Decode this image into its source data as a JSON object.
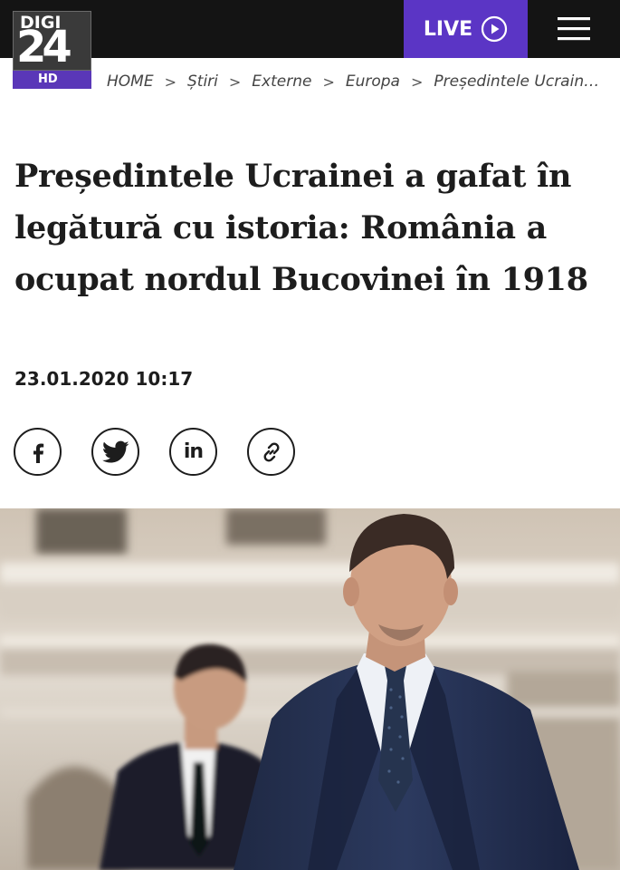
{
  "header": {
    "logo": {
      "brand": "DIGI",
      "number": "24",
      "badge": "HD"
    },
    "live_label": "LIVE",
    "live_icon": "play-circle-icon",
    "menu_icon": "hamburger-menu-icon"
  },
  "breadcrumb": {
    "items": [
      "HOME",
      "Știri",
      "Externe",
      "Europa",
      "Președintele Ucrain…"
    ],
    "separator": ">"
  },
  "article": {
    "title": "Președintele Ucrainei a gafat în legătură cu istoria: România a ocupat nordul Bucovinei în 1918",
    "date": "23.01.2020 10:17",
    "share": [
      {
        "name": "facebook",
        "icon": "facebook-icon",
        "glyph": "f"
      },
      {
        "name": "twitter",
        "icon": "twitter-icon"
      },
      {
        "name": "linkedin",
        "icon": "linkedin-icon",
        "glyph": "in"
      },
      {
        "name": "copy-link",
        "icon": "link-icon"
      }
    ],
    "photo": {
      "content": "two men in dark suits in front of a pale building"
    }
  },
  "colors": {
    "header_bg": "#141414",
    "live_bg": "#5b35c5",
    "logo_badge": "#5a37b8",
    "text": "#1d1d1d"
  }
}
